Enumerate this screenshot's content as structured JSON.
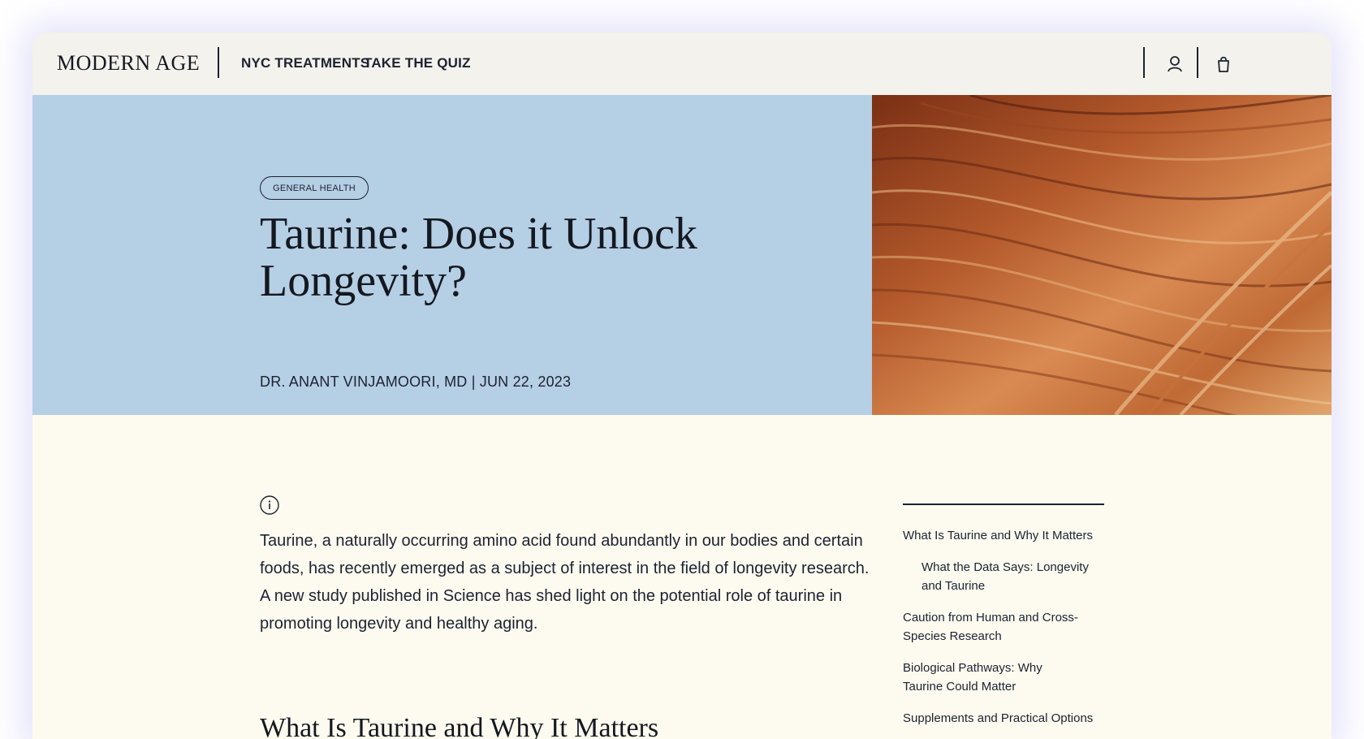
{
  "header": {
    "logo": "MODERN AGE",
    "nav": [
      {
        "label": "NYC TREATMENTS"
      },
      {
        "label": "TAKE THE QUIZ"
      }
    ],
    "icons": [
      "account-icon",
      "cart-icon"
    ]
  },
  "hero": {
    "tag": "GENERAL HEALTH",
    "title": "Taurine: Does it Unlock Longevity?",
    "byline": "DR. ANANT VINJAMOORI, MD | JUN 22, 2023",
    "background_color": "#b5cfe5"
  },
  "article": {
    "intro": "Taurine, a naturally occurring amino acid found abundantly in our bodies and certain foods, has recently emerged as a subject of interest in the field of longevity research. A new study published in Science has shed light on the potential role of taurine in promoting longevity and healthy aging.",
    "heading": "What Is Taurine and Why It Matters"
  },
  "toc": {
    "items": [
      {
        "label": "What Is Taurine and Why It Matters"
      },
      {
        "label": "What the Data Says: Longevity and Taurine"
      },
      {
        "label": "Caution from Human and Cross-Species Research"
      },
      {
        "label": "Biological Pathways: Why Taurine Could Matter"
      },
      {
        "label": "Supplements and Practical Options"
      }
    ]
  },
  "colors": {
    "header_bg": "#f3f2ec",
    "body_bg": "#fdfbf0",
    "text": "#1d2230"
  }
}
